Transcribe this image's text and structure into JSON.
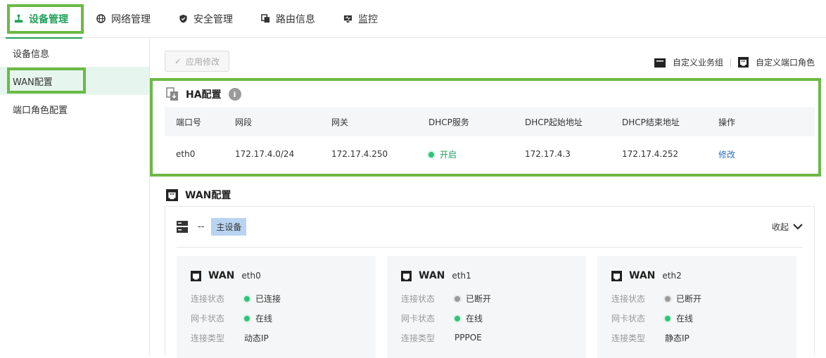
{
  "nav": {
    "tabs": [
      {
        "label": "设备管理",
        "icon": "device-icon"
      },
      {
        "label": "网络管理",
        "icon": "globe-icon"
      },
      {
        "label": "安全管理",
        "icon": "shield-icon"
      },
      {
        "label": "路由信息",
        "icon": "route-icon"
      },
      {
        "label": "监控",
        "icon": "monitor-icon"
      }
    ]
  },
  "sidebar": {
    "items": [
      {
        "label": "设备信息"
      },
      {
        "label": "WAN配置"
      },
      {
        "label": "端口角色配置"
      }
    ]
  },
  "toolbar": {
    "apply_label": "应用修改",
    "custom_group_label": "自定义业务组",
    "custom_port_role_label": "自定义端口角色"
  },
  "ha": {
    "title": "HA配置",
    "info_glyph": "i",
    "columns": [
      "端口号",
      "网段",
      "网关",
      "DHCP服务",
      "DHCP起始地址",
      "DHCP结束地址",
      "操作"
    ],
    "row": {
      "port": "eth0",
      "subnet": "172.17.4.0/24",
      "gateway": "172.17.4.250",
      "dhcp": "开启",
      "dhcp_start": "172.17.4.3",
      "dhcp_end": "172.17.4.252",
      "action": "修改"
    }
  },
  "wan": {
    "title": "WAN配置",
    "device_dash": "--",
    "device_badge": "主设备",
    "collapse_label": "收起",
    "labels": {
      "conn": "连接状态",
      "nic": "网卡状态",
      "type": "连接类型"
    },
    "cards": [
      {
        "wan": "WAN",
        "iface": "eth0",
        "conn": "已连接",
        "conn_ok": true,
        "nic": "在线",
        "type": "动态IP"
      },
      {
        "wan": "WAN",
        "iface": "eth1",
        "conn": "已断开",
        "conn_ok": false,
        "nic": "在线",
        "type": "PPPOE"
      },
      {
        "wan": "WAN",
        "iface": "eth2",
        "conn": "已断开",
        "conn_ok": false,
        "nic": "在线",
        "type": "静态IP"
      }
    ]
  },
  "colors": {
    "accent": "#20a05a",
    "highlight": "#6cb946",
    "link": "#2a6fc9"
  }
}
